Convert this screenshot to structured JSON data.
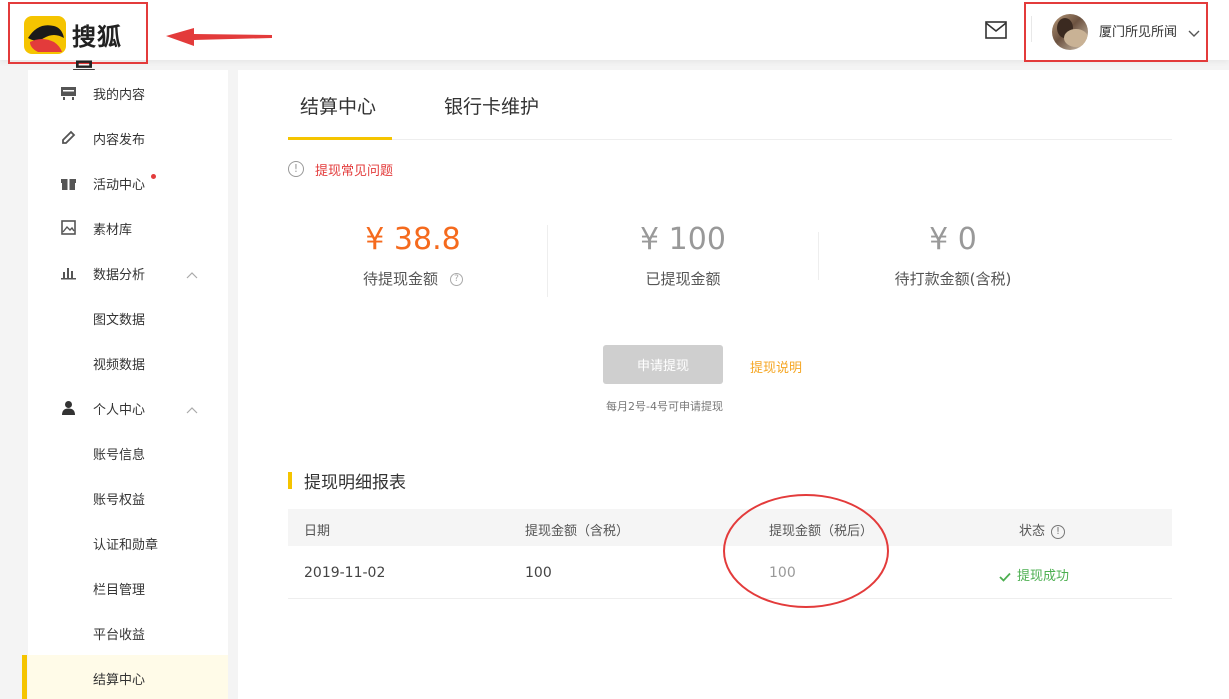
{
  "header": {
    "logo_text": "搜狐号",
    "user_name": "厦门所见所闻",
    "icons": {
      "mail": "mail-icon",
      "chevron": "chevron-down-icon",
      "logo": "sohu-fox-logo"
    }
  },
  "sidebar": {
    "items": [
      {
        "label": "我的内容",
        "icon": "content-icon"
      },
      {
        "label": "内容发布",
        "icon": "pencil-icon"
      },
      {
        "label": "活动中心",
        "icon": "gift-icon",
        "badge_dot": true
      },
      {
        "label": "素材库",
        "icon": "image-icon"
      },
      {
        "label": "数据分析",
        "icon": "bar-chart-icon",
        "expanded": true
      },
      {
        "label": "图文数据",
        "sub": true
      },
      {
        "label": "视频数据",
        "sub": true
      },
      {
        "label": "个人中心",
        "icon": "user-icon",
        "expanded": true
      },
      {
        "label": "账号信息",
        "sub": true
      },
      {
        "label": "账号权益",
        "sub": true
      },
      {
        "label": "认证和勋章",
        "sub": true
      },
      {
        "label": "栏目管理",
        "sub": true
      },
      {
        "label": "平台收益",
        "sub": true
      },
      {
        "label": "结算中心",
        "sub": true,
        "active": true
      }
    ]
  },
  "main": {
    "tabs": [
      {
        "label": "结算中心",
        "active": true
      },
      {
        "label": "银行卡维护",
        "active": false
      }
    ],
    "faq_link": "提现常见问题",
    "stats": [
      {
        "amount": "¥ 38.8",
        "label": "待提现金额",
        "help": "?"
      },
      {
        "amount": "¥ 100",
        "label": "已提现金额"
      },
      {
        "amount": "¥ 0",
        "label": "待打款金额(含税)"
      }
    ],
    "apply_button": "申请提现",
    "apply_link": "提现说明",
    "apply_note": "每月2号-4号可申请提现",
    "section_title": "提现明细报表",
    "table": {
      "headers": [
        "日期",
        "提现金额（含税）",
        "提现金额（税后）",
        "状态"
      ],
      "rows": [
        {
          "date": "2019-11-02",
          "amount_pre_tax": "100",
          "amount_post_tax": "100",
          "status": "提现成功"
        }
      ]
    }
  },
  "colors": {
    "accent_yellow": "#f5c400",
    "orange": "#f56a1d",
    "red": "#e33b3b",
    "success": "#4caf50",
    "link_orange": "#f5a623"
  }
}
